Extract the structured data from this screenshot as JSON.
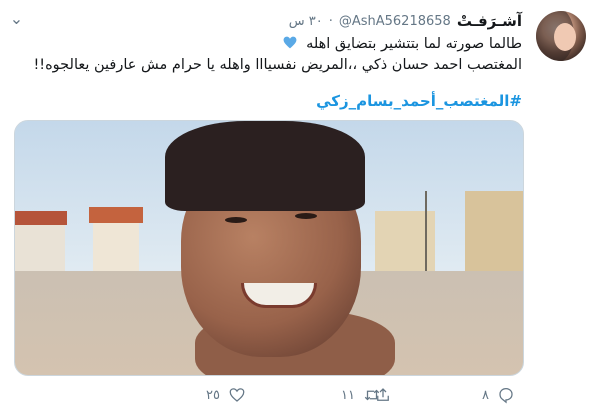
{
  "tweet": {
    "author": {
      "display_name": "آشـرَفـتْ",
      "handle": "@AshA56218658",
      "time": "٣٠ س",
      "dot": "·"
    },
    "text_line1": "طالما صورته لما بتتشير بتضايق اهله",
    "text_line2": "المغتصب احمد حسان ذكي ،،المريض نفسيااا واهله يا حرام مش عارفين يعالجوه!!",
    "hashtag": "#المغتصب_أحمد_بسام_زكي",
    "actions": {
      "reply_count": "٨",
      "retweet_count": "١١",
      "like_count": "٢٥",
      "share_icon": "share-icon"
    },
    "colors": {
      "link": "#1b95e0",
      "heart": "#5aa9e6",
      "muted": "#657786"
    }
  }
}
